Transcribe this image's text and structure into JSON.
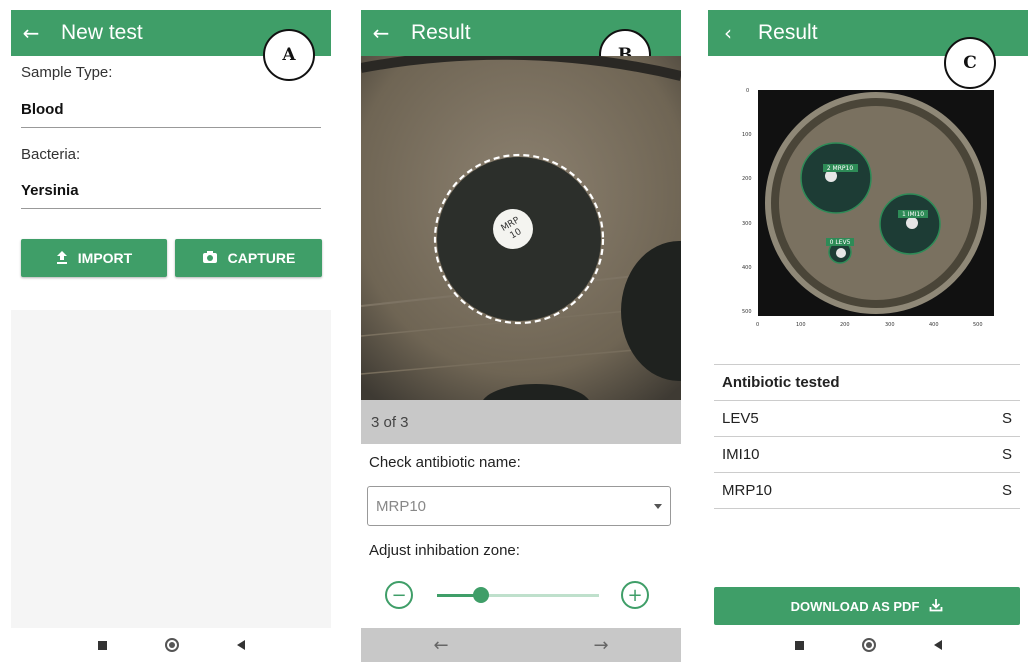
{
  "panels": {
    "a": {
      "label": "A",
      "app_bar": {
        "back_icon": "arrow-left-icon",
        "title": "New test"
      },
      "sample_type": {
        "label": "Sample Type:",
        "value": "Blood"
      },
      "bacteria": {
        "label": "Bacteria:",
        "value": "Yersinia"
      },
      "buttons": {
        "import": "IMPORT",
        "capture": "CAPTURE"
      }
    },
    "b": {
      "label": "B",
      "app_bar": {
        "back_icon": "arrow-left-icon",
        "title": "Result"
      },
      "disc_label_line1": "MRP",
      "disc_label_line2": "10",
      "counter": "3 of 3",
      "check_label": "Check antibiotic name:",
      "antibiotic_select": {
        "value": "MRP10"
      },
      "adjust_label": "Adjust inhibation zone:",
      "slider": {
        "level": 0.27
      },
      "nav": {
        "prev_icon": "arrow-left-icon",
        "next_icon": "arrow-right-icon"
      }
    },
    "c": {
      "label": "C",
      "app_bar": {
        "back_icon": "chevron-left-icon",
        "title": "Result"
      },
      "plot": {
        "y_ticks": [
          "0",
          "100",
          "200",
          "300",
          "400",
          "500"
        ],
        "x_ticks": [
          "0",
          "100",
          "200",
          "300",
          "400",
          "500"
        ],
        "zone_labels": [
          "2 MRP10",
          "1 IMI10",
          "0 LEV5"
        ]
      },
      "table": {
        "header": "Antibiotic tested",
        "rows": [
          {
            "name": "LEV5",
            "result": "S"
          },
          {
            "name": "IMI10",
            "result": "S"
          },
          {
            "name": "MRP10",
            "result": "S"
          }
        ]
      },
      "download_button": "DOWNLOAD AS PDF"
    }
  },
  "colors": {
    "accent": "#3f9e68",
    "zone_label": "#2e8b57"
  }
}
